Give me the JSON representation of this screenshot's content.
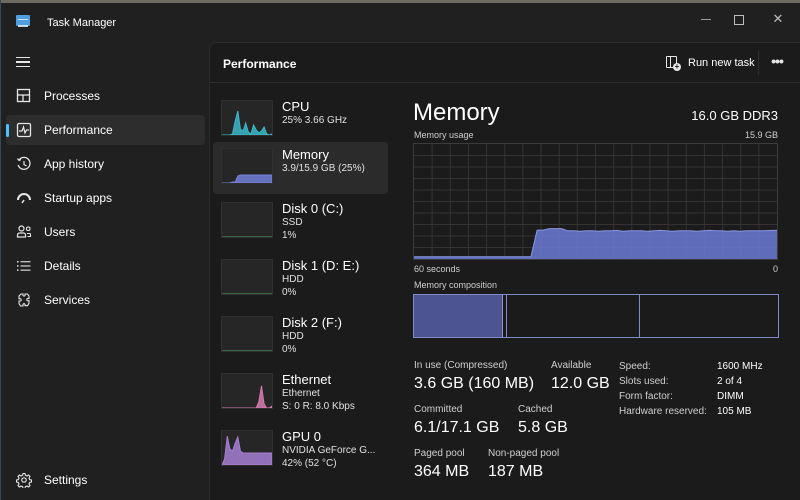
{
  "window": {
    "title": "Task Manager",
    "controls": {
      "minimize": "minimize",
      "maximize": "maximize",
      "close": "close"
    }
  },
  "sidebar": {
    "menu_icon": "hamburger-icon",
    "items": [
      {
        "label": "Processes",
        "icon": "processes-grid-icon",
        "active": false
      },
      {
        "label": "Performance",
        "icon": "performance-pulse-icon",
        "active": true
      },
      {
        "label": "App history",
        "icon": "history-clock-icon",
        "active": false
      },
      {
        "label": "Startup apps",
        "icon": "speedometer-icon",
        "active": false
      },
      {
        "label": "Users",
        "icon": "users-icon",
        "active": false
      },
      {
        "label": "Details",
        "icon": "list-icon",
        "active": false
      },
      {
        "label": "Services",
        "icon": "puzzle-gear-icon",
        "active": false
      }
    ],
    "settings": {
      "label": "Settings",
      "icon": "gear-icon"
    }
  },
  "header": {
    "title": "Performance",
    "run_new_task": "Run new task",
    "more": "•••"
  },
  "resources": [
    {
      "name": "CPU",
      "line1": "25%  3.66 GHz",
      "line2": "",
      "color": "#3bb7c9",
      "active": false
    },
    {
      "name": "Memory",
      "line1": "3.9/15.9 GB (25%)",
      "line2": "",
      "color": "#7280d8",
      "active": true
    },
    {
      "name": "Disk 0 (C:)",
      "line1": "SSD",
      "line2": "1%",
      "color": "#4ea35e",
      "active": false
    },
    {
      "name": "Disk 1 (D: E:)",
      "line1": "HDD",
      "line2": "0%",
      "color": "#4ea35e",
      "active": false
    },
    {
      "name": "Disk 2 (F:)",
      "line1": "HDD",
      "line2": "0%",
      "color": "#4ea35e",
      "active": false
    },
    {
      "name": "Ethernet",
      "line1": "Ethernet",
      "line2": "S: 0 R: 8.0 Kbps",
      "color": "#d87bb0",
      "active": false
    },
    {
      "name": "GPU 0",
      "line1": "NVIDIA GeForce G...",
      "line2": "42%  (52 °C)",
      "color": "#a67fd4",
      "active": false
    }
  ],
  "memory": {
    "title": "Memory",
    "spec": "16.0 GB DDR3",
    "usage_label": "Memory usage",
    "usage_max": "15.9 GB",
    "time_left": "60 seconds",
    "time_right": "0",
    "composition_label": "Memory composition",
    "composition": {
      "in_use_fraction": 0.245,
      "modified_fraction": 0.012,
      "standby_fraction": 0.366,
      "total_gb": 15.9
    },
    "usage_history_gb": [
      0.3,
      0.3,
      0.3,
      0.3,
      0.3,
      0.3,
      0.3,
      0.3,
      0.3,
      0.3,
      0.3,
      0.3,
      0.3,
      0.3,
      0.3,
      0.3,
      0.3,
      0.3,
      0.3,
      0.3,
      4.0,
      4.0,
      4.2,
      4.2,
      4.2,
      3.9,
      3.9,
      3.85,
      3.9,
      3.9,
      3.85,
      3.9,
      3.9,
      3.95,
      3.85,
      3.9,
      3.9,
      3.9,
      3.85,
      3.9,
      3.95,
      3.9,
      3.85,
      3.9,
      3.9,
      3.9,
      3.85,
      3.9,
      3.95,
      3.9,
      3.9,
      3.85,
      3.9,
      3.85,
      3.9,
      3.9,
      3.9,
      3.9,
      3.95,
      3.95
    ],
    "stats": [
      {
        "label": "In use (Compressed)",
        "value": "3.6 GB (160 MB)"
      },
      {
        "label": "Available",
        "value": "12.0 GB"
      },
      {
        "label": "Committed",
        "value": "6.1/17.1 GB"
      },
      {
        "label": "Cached",
        "value": "5.8 GB"
      },
      {
        "label": "Paged pool",
        "value": "364 MB"
      },
      {
        "label": "Non-paged pool",
        "value": "187 MB"
      }
    ],
    "specs": [
      {
        "label": "Speed:",
        "value": "1600 MHz"
      },
      {
        "label": "Slots used:",
        "value": "2 of 4"
      },
      {
        "label": "Form factor:",
        "value": "DIMM"
      },
      {
        "label": "Hardware reserved:",
        "value": "105 MB"
      }
    ]
  },
  "colors": {
    "accent": "#4cc2ff",
    "memory_fill": "#6677cc",
    "memory_line": "#7f8bc9",
    "background": "#202020",
    "panel": "#1b1b1b"
  }
}
